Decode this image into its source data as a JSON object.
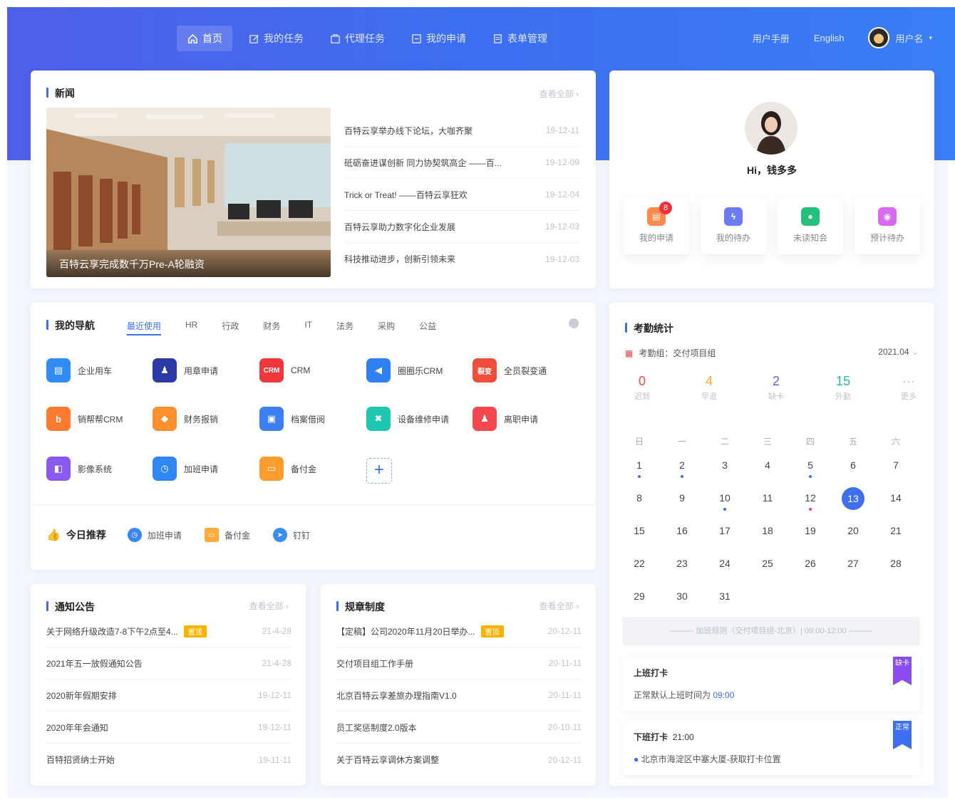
{
  "nav": {
    "items": [
      {
        "label": "首页",
        "icon": "home-icon",
        "active": true
      },
      {
        "label": "我的任务",
        "icon": "edit-icon",
        "active": false
      },
      {
        "label": "代理任务",
        "icon": "proxy-icon",
        "active": false
      },
      {
        "label": "我的申请",
        "icon": "apply-icon",
        "active": false
      },
      {
        "label": "表单管理",
        "icon": "form-icon",
        "active": false
      }
    ],
    "manual": "用户手册",
    "lang": "English",
    "username": "用户名"
  },
  "news": {
    "title": "新闻",
    "more": "查看全部 ›",
    "caption": "百特云享完成数千万Pre-A轮融资",
    "items": [
      {
        "title": "百特云享举办线下论坛，大咖齐聚",
        "date": "19-12-11"
      },
      {
        "title": "砥砺奋进谋创新 同力协契筑高企 ——百...",
        "date": "19-12-09"
      },
      {
        "title": "Trick or Treat! ——百特云享狂欢",
        "date": "19-12-04"
      },
      {
        "title": "百特云享助力数字化企业发展",
        "date": "19-12-03"
      },
      {
        "title": "科技推动进步，创新引领未来",
        "date": "19-12-03"
      }
    ]
  },
  "profile": {
    "greeting": "Hi，钱多多",
    "actions": [
      {
        "label": "我的申请",
        "icon": "my-apply-icon",
        "color": "#ff8a4c",
        "badge": "8"
      },
      {
        "label": "我的待办",
        "icon": "lightning-icon",
        "color": "#6b7bf5",
        "badge": ""
      },
      {
        "label": "未读知会",
        "icon": "chat-icon",
        "color": "#25c07a",
        "badge": ""
      },
      {
        "label": "预计待办",
        "icon": "clock-icon",
        "color": "#d86af0",
        "badge": ""
      }
    ]
  },
  "mynav": {
    "title": "我的导航",
    "tabs": [
      "最近使用",
      "HR",
      "行政",
      "财务",
      "IT",
      "法务",
      "采购",
      "公益"
    ],
    "apps": [
      {
        "label": "企业用车",
        "glyph": "▤",
        "color": "#2f8cf6"
      },
      {
        "label": "用章申请",
        "glyph": "♟",
        "color": "#2c3aa8"
      },
      {
        "label": "CRM",
        "glyph": "CRM",
        "color": "#f0373c"
      },
      {
        "label": "圈圈乐CRM",
        "glyph": "◀",
        "color": "#2f80f0"
      },
      {
        "label": "全员裂变通",
        "glyph": "裂变",
        "color": "#f04d3c"
      },
      {
        "label": "销帮帮CRM",
        "glyph": "b",
        "color": "#ff7a2f"
      },
      {
        "label": "财务报销",
        "glyph": "◆",
        "color": "#ff8f2f"
      },
      {
        "label": "档案借阅",
        "glyph": "▣",
        "color": "#3b7ff2"
      },
      {
        "label": "设备维修申请",
        "glyph": "✖",
        "color": "#1fc6b0"
      },
      {
        "label": "离职申请",
        "glyph": "♟",
        "color": "#f5474e"
      },
      {
        "label": "影像系统",
        "glyph": "◧",
        "color": "#8a5af0"
      },
      {
        "label": "加班申请",
        "glyph": "◷",
        "color": "#2f86f5"
      },
      {
        "label": "备付金",
        "glyph": "▭",
        "color": "#ff9c2f"
      }
    ],
    "add": "+",
    "rec_title": "今日推荐",
    "recs": [
      {
        "label": "加班申请",
        "color": "#3b86f5"
      },
      {
        "label": "备付金",
        "color": "#ffab3a"
      },
      {
        "label": "钉钉",
        "color": "#3a8cf5"
      }
    ]
  },
  "notice": {
    "title": "通知公告",
    "more": "查看全部 ›",
    "items": [
      {
        "title": "关于网络升级改造7-8下午2点至4...",
        "tag": "置顶",
        "date": "21-4-28"
      },
      {
        "title": "2021年五一放假通知公告",
        "tag": "",
        "date": "21-4-28"
      },
      {
        "title": "2020新年假期安排",
        "tag": "",
        "date": "19-12-11"
      },
      {
        "title": "2020年年会通知",
        "tag": "",
        "date": "19-12-11"
      },
      {
        "title": "百特招贤纳士开始",
        "tag": "",
        "date": "19-11-11"
      }
    ]
  },
  "rules": {
    "title": "规章制度",
    "more": "查看全部 ›",
    "items": [
      {
        "title": "【定稿】公司2020年11月20日举办...",
        "tag": "置顶",
        "date": "20-12-11"
      },
      {
        "title": "交付项目组工作手册",
        "tag": "",
        "date": "20-11-11"
      },
      {
        "title": "北京百特云享差旅办理指南V1.0",
        "tag": "",
        "date": "20-11-11"
      },
      {
        "title": "员工奖惩制度2.0版本",
        "tag": "",
        "date": "20-10-11"
      },
      {
        "title": "关于百特云享调休方案调整",
        "tag": "",
        "date": "20-12-11"
      }
    ]
  },
  "attendance": {
    "title": "考勤统计",
    "group": "考勤组：交付项目组",
    "month": "2021.04",
    "stats": [
      {
        "n": "0",
        "l": "迟到",
        "color": "#f5474e"
      },
      {
        "n": "4",
        "l": "早退",
        "color": "#f5a623"
      },
      {
        "n": "2",
        "l": "缺卡",
        "color": "#7a52e8"
      },
      {
        "n": "15",
        "l": "外勤",
        "color": "#1fbfa8"
      },
      {
        "n": "···",
        "l": "更多",
        "color": "#c9cdd6"
      }
    ],
    "weekdays": [
      "日",
      "一",
      "二",
      "三",
      "四",
      "五",
      "六"
    ],
    "weeks": [
      [
        "1",
        "2",
        "3",
        "4",
        "5",
        "6",
        "7"
      ],
      [
        "8",
        "9",
        "10",
        "11",
        "12",
        "13",
        "14"
      ],
      [
        "15",
        "16",
        "17",
        "18",
        "19",
        "20",
        "21"
      ],
      [
        "22",
        "23",
        "24",
        "25",
        "26",
        "27",
        "28"
      ],
      [
        "29",
        "30",
        "31",
        "",
        "",
        "",
        ""
      ]
    ],
    "today": "13",
    "blue_dots": [
      "1",
      "2",
      "5",
      "10"
    ],
    "red_dots": [
      "12"
    ],
    "rule": "——— 加班规则（交付项目组-北京）| 09:00-12:00 ———",
    "checkin_title": "上班打卡",
    "checkin_text": "正常默认上班时间为",
    "checkin_time": "09:00",
    "checkin_flag": "缺卡",
    "checkout_title": "下班打卡",
    "checkout_time": "21:00",
    "checkout_loc": "北京市海淀区中塞大厦-获取打卡位置",
    "checkout_flag": "正常",
    "colors": {
      "purple": "#8a4cf0",
      "blue": "#3d6ff0"
    }
  }
}
